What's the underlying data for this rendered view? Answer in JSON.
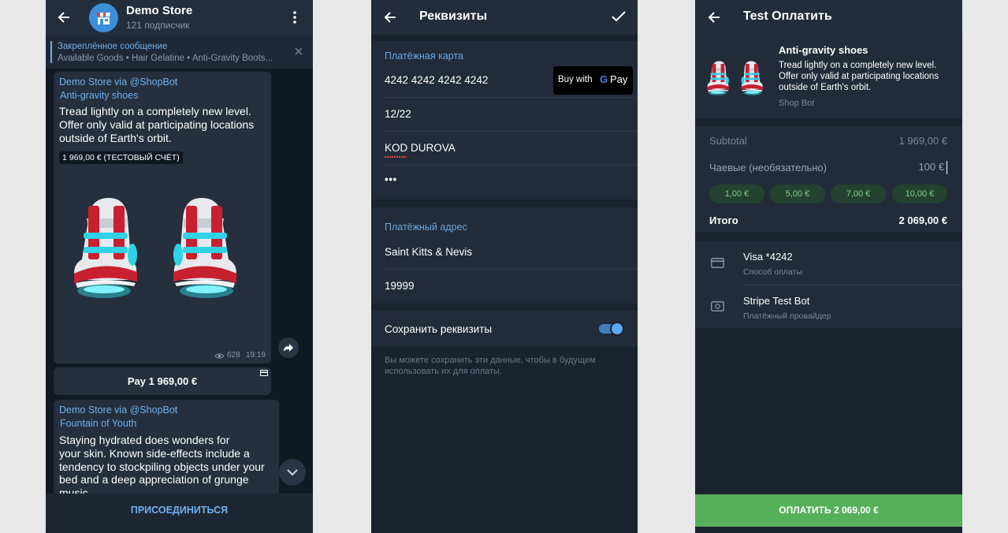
{
  "chat": {
    "title": "Demo Store",
    "subtitle": "121 подписчик",
    "pinned_label": "Закреплённое сообщение",
    "pinned_text": "Available Goods • Hair Gelatine • Anti-Gravity Boots...",
    "msg1": {
      "sender": "Demo Store via @ShopBot",
      "product": "Anti-gravity shoes",
      "text": [
        "Tread lightly on a completely new level.",
        "Offer only valid at participating locations",
        "outside of Earth's orbit."
      ],
      "price_badge": "1 969,00 € (ТЕСТОВЫЙ СЧЁТ)",
      "views": "628",
      "time": "19:19"
    },
    "pay_button": "Pay 1 969,00 €",
    "msg2": {
      "sender": "Demo Store via @ShopBot",
      "product": "Fountain of Youth",
      "text": [
        "Staying hydrated does wonders for",
        "your skin. Known side-effects include a",
        "tendency to stockpiling objects under your",
        "bed and a deep appreciation of grunge",
        "music."
      ]
    },
    "join_button": "ПРИСОЕДИНИТЬСЯ"
  },
  "details": {
    "title": "Реквизиты",
    "card_section": "Платёжная карта",
    "card_number": "4242 4242 4242 4242",
    "gpay_label": "Buy with",
    "gpay_g": "G",
    "gpay_pay": "Pay",
    "expiry": "12/22",
    "cardholder": "KOD DUROVA",
    "cvc": "•••",
    "address_section": "Платёжный адрес",
    "country": "Saint Kitts & Nevis",
    "zip": "19999",
    "save_label": "Сохранить реквизиты",
    "save_on": true,
    "hint": [
      "Вы можете сохранить эти данные, чтобы в будущем",
      "использовать их для оплаты."
    ]
  },
  "checkout": {
    "title": "Test Оплатить",
    "product": "Anti-gravity shoes",
    "desc": [
      "Tread lightly on a completely new level.",
      "Offer only valid at participating locations",
      "outside of Earth's orbit."
    ],
    "seller": "Shop Bot",
    "subtotal_label": "Subtotal",
    "subtotal_value": "1 969,00 €",
    "tips_label": "Чаевые (необязательно)",
    "tips_value": "100 €",
    "chips": [
      "1,00 €",
      "5,00 €",
      "7,00 €",
      "10,00 €"
    ],
    "total_label": "Итого",
    "total_value": "2 069,00 €",
    "method_title": "Visa *4242",
    "method_sub": "Способ оплаты",
    "provider_title": "Stripe Test Bot",
    "provider_sub": "Платёжный провайдер",
    "pay_button": "ОПЛАТИТЬ 2 069,00 €"
  },
  "colors": {
    "accent": "#6fb0ee",
    "pay_green": "#56b05a",
    "chip_text": "#83d28a",
    "bg": "#1b2230"
  }
}
